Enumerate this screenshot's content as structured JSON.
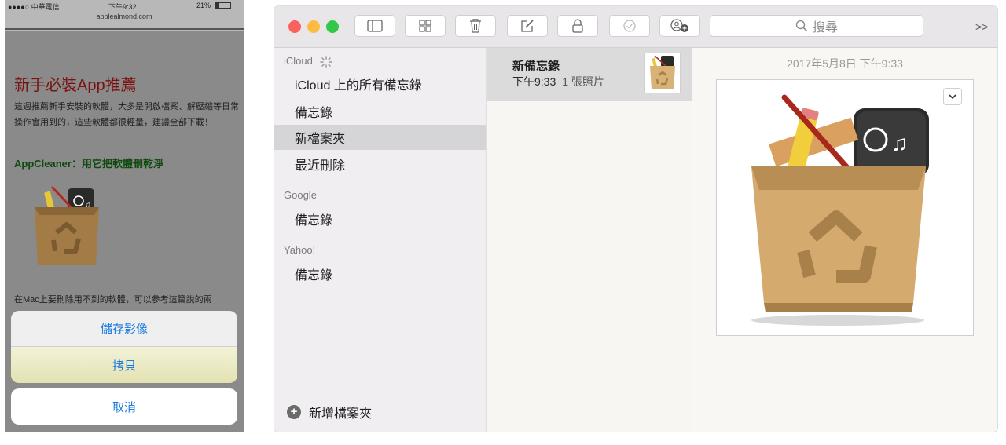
{
  "phone": {
    "status": {
      "carrier": "●●●●○ 中華電信",
      "time": "下午9:32",
      "battery": "21%",
      "url": "applealmond.com"
    },
    "article": {
      "title": "新手必裝App推薦",
      "paragraph1": "這週推薦新手安裝的軟體，大多是開啟檔案、解壓縮等日常操作會用到的，這些軟體都很輕量，建議全部下載！",
      "subtitle": "AppCleaner：用它把軟體刪乾淨",
      "paragraph2": "在Mac上要刪除用不到的軟體，可以參考這篇說的兩"
    },
    "action_sheet": {
      "save_label": "儲存影像",
      "copy_label": "拷貝",
      "cancel_label": "取消"
    }
  },
  "mac_notes": {
    "toolbar": {
      "buttons": [
        "sidebar-toggle-icon",
        "attachments-browser-icon",
        "trash-icon",
        "compose-icon",
        "lock-icon",
        "checklist-icon",
        "add-people-icon"
      ],
      "search_placeholder": "搜尋",
      "overflow": ">>"
    },
    "sidebar": {
      "groups": [
        {
          "name": "iCloud",
          "items": [
            "iCloud 上的所有備忘錄",
            "備忘錄",
            "新檔案夾",
            "最近刪除"
          ],
          "selected": "新檔案夾"
        },
        {
          "name": "Google",
          "items": [
            "備忘錄"
          ]
        },
        {
          "name": "Yahoo!",
          "items": [
            "備忘錄"
          ]
        }
      ],
      "new_folder_label": "新增檔案夾"
    },
    "note_list": [
      {
        "title": "新備忘錄",
        "time": "下午9:33",
        "attachment": "1 張照片"
      }
    ],
    "editor": {
      "date": "2017年5月8日 下午9:33"
    },
    "colors": {
      "close": "#fc605c",
      "minimize": "#fdbc40",
      "zoom": "#34c84a",
      "selected_row": "#d5d4d6"
    }
  }
}
